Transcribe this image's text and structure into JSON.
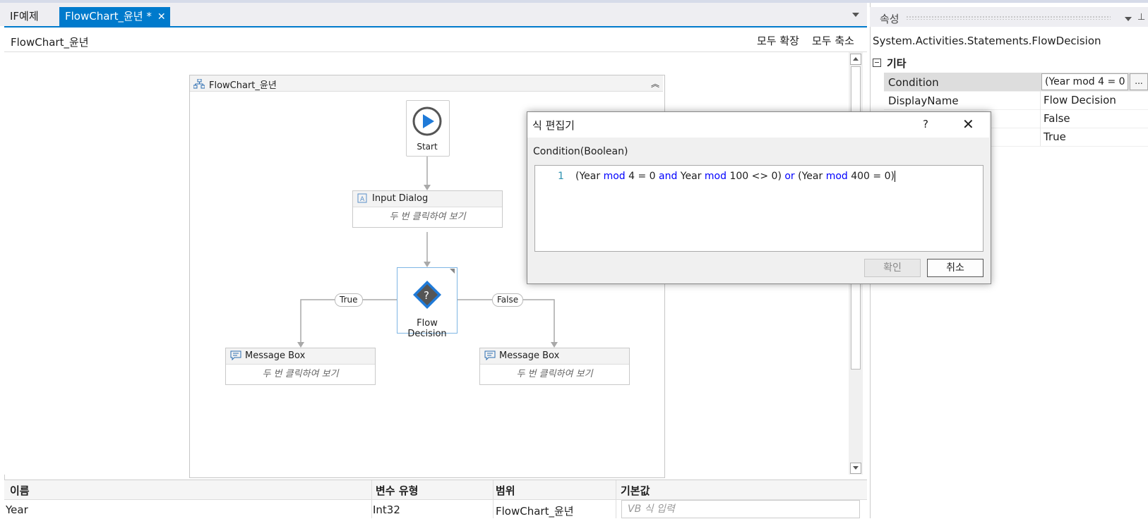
{
  "tabs": [
    {
      "label": "IF예제",
      "active": false
    },
    {
      "label": "FlowChart_윤년 *",
      "active": true
    }
  ],
  "tab_close_icon": "close-icon",
  "designer": {
    "breadcrumb": "FlowChart_윤년",
    "expand_all": "모두 확장",
    "collapse_all": "모두 축소"
  },
  "flowchart": {
    "title": "FlowChart_윤년",
    "start_label": "Start",
    "input_dialog": {
      "title": "Input Dialog",
      "hint": "두 번 클릭하여 보기"
    },
    "decision": {
      "label": "Flow Decision",
      "true_label": "True",
      "false_label": "False"
    },
    "msg_left": {
      "title": "Message Box",
      "hint": "두 번 클릭하여 보기"
    },
    "msg_right": {
      "title": "Message Box",
      "hint": "두 번 클릭하여 보기"
    }
  },
  "variables": {
    "headers": [
      "이름",
      "변수 유형",
      "범위",
      "기본값"
    ],
    "rows": [
      {
        "name": "Year",
        "type": "Int32",
        "scope": "FlowChart_윤년",
        "default_placeholder": "VB 식 입력"
      }
    ]
  },
  "properties": {
    "title": "속성",
    "pin_icon": "pin-icon",
    "type_name": "System.Activities.Statements.FlowDecision",
    "category": "기타",
    "rows": [
      {
        "name": "Condition",
        "value": "(Year mod 4 = 0"
      },
      {
        "name": "DisplayName",
        "value": "Flow Decision"
      },
      {
        "name": "",
        "value": "False"
      },
      {
        "name": "",
        "value": "True"
      }
    ],
    "ellipsis": "..."
  },
  "dialog": {
    "title": "식 편집기",
    "help": "?",
    "close": "✕",
    "label": "Condition(Boolean)",
    "line_number": "1",
    "code_tokens": [
      {
        "t": "(Year ",
        "kw": false
      },
      {
        "t": "mod",
        "kw": true
      },
      {
        "t": " 4 = 0 ",
        "kw": false
      },
      {
        "t": "and",
        "kw": true
      },
      {
        "t": " Year ",
        "kw": false
      },
      {
        "t": "mod",
        "kw": true
      },
      {
        "t": " 100 <> 0) ",
        "kw": false
      },
      {
        "t": "or",
        "kw": true
      },
      {
        "t": " (Year ",
        "kw": false
      },
      {
        "t": "mod",
        "kw": true
      },
      {
        "t": " 400 = 0)",
        "kw": false
      }
    ],
    "ok": "확인",
    "cancel": "취소"
  }
}
